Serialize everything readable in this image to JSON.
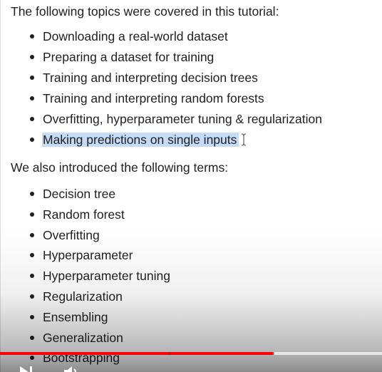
{
  "document": {
    "intro": "The following topics were covered in this tutorial:",
    "topics": [
      "Downloading a real-world dataset",
      "Preparing a dataset for training",
      "Training and interpreting decision trees",
      "Training and interpreting random forests",
      "Overfitting, hyperparameter tuning & regularization",
      "Making predictions on single inputs"
    ],
    "selected_topic_index": 5,
    "terms_intro": "We also introduced the following terms:",
    "terms": [
      "Decision tree",
      "Random forest",
      "Overfitting",
      "Hyperparameter",
      "Hyperparameter tuning",
      "Regularization",
      "Ensembling",
      "Generalization",
      "Bootstrapping"
    ]
  },
  "player": {
    "progress_played_pct": 71.5,
    "progress_loaded_pct": 100,
    "colors": {
      "played": "#ff0000",
      "selection": "#c6dbf6"
    },
    "icons": [
      "skip-next-icon",
      "volume-icon"
    ]
  }
}
